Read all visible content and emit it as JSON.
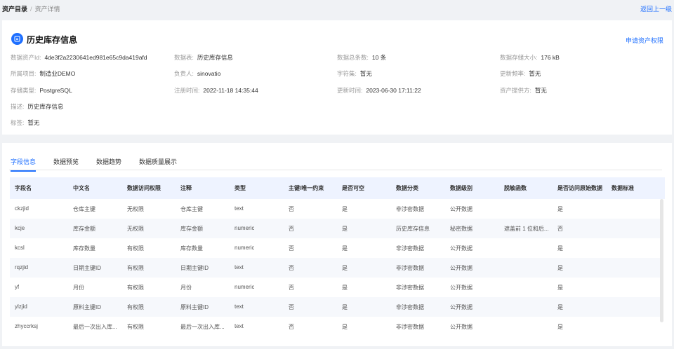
{
  "breadcrumb": {
    "root": "资产目录",
    "separator": "/",
    "current": "资产详情"
  },
  "back_link": "返回上一级",
  "asset": {
    "title": "历史库存信息",
    "apply_link": "申请资产权限",
    "fields": {
      "asset_id": {
        "label": "数据资产Id:",
        "value": "4de3f2a2230641ed981e65c9da419afd"
      },
      "table": {
        "label": "数据表:",
        "value": "历史库存信息"
      },
      "total": {
        "label": "数据总条数:",
        "value": "10 条"
      },
      "size": {
        "label": "数据存储大小:",
        "value": "176 kB"
      },
      "project": {
        "label": "所属项目:",
        "value": "制造业DEMO"
      },
      "owner": {
        "label": "负责人:",
        "value": "sinovatio"
      },
      "charset": {
        "label": "字符集:",
        "value": "暂无"
      },
      "frequency": {
        "label": "更新频率:",
        "value": "暂无"
      },
      "storage": {
        "label": "存储类型:",
        "value": "PostgreSQL"
      },
      "registered": {
        "label": "注册时间:",
        "value": "2022-11-18 14:35:44"
      },
      "updated": {
        "label": "更新时间:",
        "value": "2023-06-30 17:11:22"
      },
      "provider": {
        "label": "资产提供方:",
        "value": "暂无"
      },
      "description": {
        "label": "描述:",
        "value": "历史库存信息"
      },
      "tags": {
        "label": "标签:",
        "value": "暂无"
      }
    }
  },
  "tabs": [
    "字段信息",
    "数据预览",
    "数据趋势",
    "数据质量展示"
  ],
  "table": {
    "headers": [
      "字段名",
      "中文名",
      "数据访问权限",
      "注释",
      "类型",
      "主键/唯一约束",
      "是否可空",
      "数据分类",
      "数据级别",
      "脱敏函数",
      "是否访问原始数据",
      "数据标准"
    ],
    "rows": [
      [
        "ckzjid",
        "仓库主键",
        "无权限",
        "仓库主键",
        "text",
        "否",
        "是",
        "非涉密数据",
        "公开数据",
        "",
        "是",
        ""
      ],
      [
        "kcje",
        "库存金额",
        "无权限",
        "库存金额",
        "numeric",
        "否",
        "是",
        "历史库存信息",
        "秘密数据",
        "遮盖前 1 位和后...",
        "否",
        ""
      ],
      [
        "kcsl",
        "库存数量",
        "有权限",
        "库存数量",
        "numeric",
        "否",
        "是",
        "非涉密数据",
        "公开数据",
        "",
        "是",
        ""
      ],
      [
        "rqzjid",
        "日期主键ID",
        "有权限",
        "日期主键ID",
        "text",
        "否",
        "是",
        "非涉密数据",
        "公开数据",
        "",
        "是",
        ""
      ],
      [
        "yf",
        "月份",
        "有权限",
        "月份",
        "numeric",
        "否",
        "是",
        "非涉密数据",
        "公开数据",
        "",
        "是",
        ""
      ],
      [
        "ylzjid",
        "原料主键ID",
        "有权限",
        "原料主键ID",
        "text",
        "否",
        "是",
        "非涉密数据",
        "公开数据",
        "",
        "是",
        ""
      ],
      [
        "zhyccrksj",
        "最后一次出入库...",
        "有权限",
        "最后一次出入库...",
        "text",
        "否",
        "是",
        "非涉密数据",
        "公开数据",
        "",
        "是",
        ""
      ]
    ]
  },
  "colors": {
    "accent": "#1e6fff",
    "header_bg": "#eef3ff",
    "page_bg": "#f0f2f5"
  },
  "icons": {
    "title": "table-icon"
  }
}
